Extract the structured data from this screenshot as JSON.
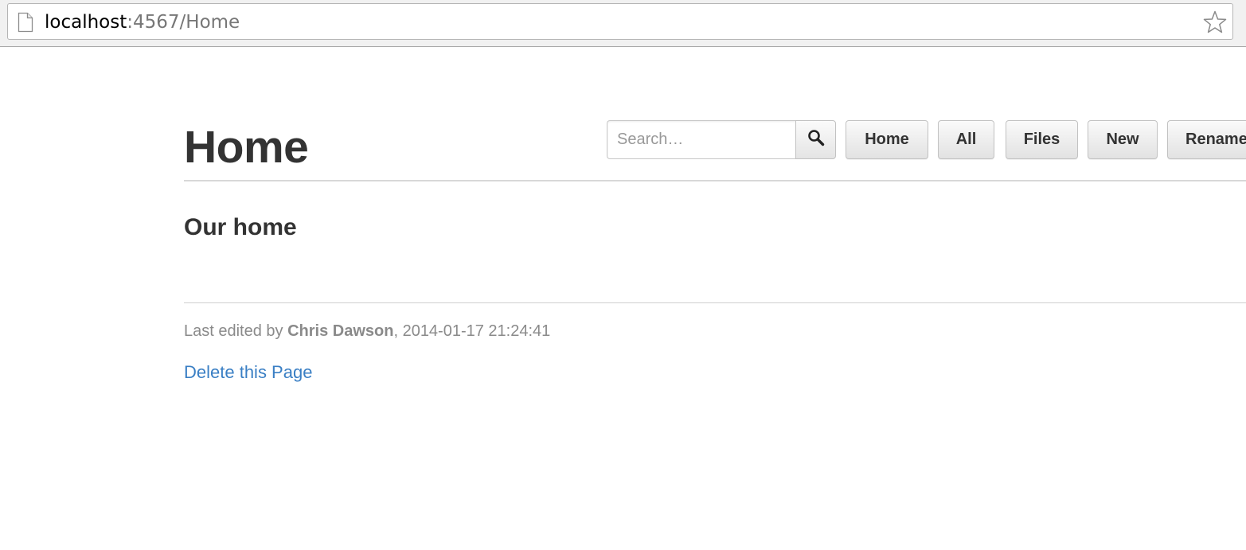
{
  "browser": {
    "url_host": "localhost",
    "url_rest": ":4567/Home"
  },
  "page": {
    "title": "Home",
    "subtitle": "Our home",
    "last_edited": {
      "prefix": "Last edited by ",
      "author": "Chris Dawson",
      "suffix": ", 2014-01-17 21:24:41"
    },
    "delete_link": "Delete this Page"
  },
  "search": {
    "placeholder": "Search…"
  },
  "nav": {
    "home": "Home",
    "all": "All",
    "files": "Files",
    "new": "New",
    "rename": "Rename"
  },
  "colors": {
    "link": "#3a7fc4",
    "heading": "#333333",
    "muted": "#8a8a8a"
  },
  "icons": {
    "omnibox_left": "page-icon",
    "omnibox_right": "star-icon",
    "search_button": "magnifier-icon"
  }
}
